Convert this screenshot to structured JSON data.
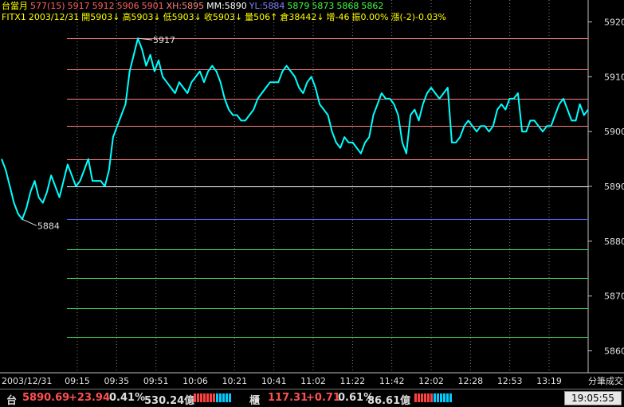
{
  "header": {
    "line1": [
      {
        "text": "台當月",
        "color": "#ffff00"
      },
      {
        "text": "577(15)",
        "color": "#ff6060"
      },
      {
        "text": "5917",
        "color": "#ff6060"
      },
      {
        "text": "5912",
        "color": "#ff6060"
      },
      {
        "text": "5906",
        "color": "#ff6060"
      },
      {
        "text": "5901",
        "color": "#ff6060"
      },
      {
        "text": "XH:5895",
        "color": "#ff8080"
      },
      {
        "text": "MM:5890",
        "color": "#ffffff"
      },
      {
        "text": "YL:5884",
        "color": "#8080ff"
      },
      {
        "text": "5879",
        "color": "#40ff40"
      },
      {
        "text": "5873",
        "color": "#40ff40"
      },
      {
        "text": "5868",
        "color": "#40ff40"
      },
      {
        "text": "5862",
        "color": "#40ff40"
      }
    ],
    "line2": [
      {
        "text": "FITX1",
        "color": "#ffff00"
      },
      {
        "text": "2003/12/31",
        "color": "#ffff00"
      },
      {
        "text": "開5903↓",
        "color": "#ffff00"
      },
      {
        "text": "高5903↓",
        "color": "#ffff00"
      },
      {
        "text": "低5903↓",
        "color": "#ffff00"
      },
      {
        "text": "收5903↓",
        "color": "#ffff00"
      },
      {
        "text": "量506↑",
        "color": "#ffff00"
      },
      {
        "text": "倉38442↓",
        "color": "#ffff00"
      },
      {
        "text": "增-46",
        "color": "#ffff00"
      },
      {
        "text": "振0.00%",
        "color": "#ffff00"
      },
      {
        "text": "漲(-2)-0.03%",
        "color": "#ffff00"
      }
    ]
  },
  "chart_data": {
    "type": "line",
    "date_label": "2003/12/31",
    "right_axis_label": "分筆成交",
    "ylim": [
      5856,
      5924
    ],
    "y_ticks": [
      5920,
      5910,
      5900,
      5890,
      5880,
      5870,
      5860
    ],
    "x_tick_labels": [
      "09:15",
      "09:35",
      "09:51",
      "10:06",
      "10:21",
      "10:41",
      "11:02",
      "11:22",
      "11:42",
      "12:02",
      "12:28",
      "12:53",
      "13:19"
    ],
    "reference_lines": [
      {
        "value": 5917,
        "color": "#ff8080"
      },
      {
        "value": 5911.3,
        "color": "#ff8080"
      },
      {
        "value": 5906,
        "color": "#ff8080"
      },
      {
        "value": 5901,
        "color": "#ff8080"
      },
      {
        "value": 5895,
        "color": "#ff8080"
      },
      {
        "value": 5890,
        "color": "#ffffff"
      },
      {
        "value": 5884,
        "color": "#6060ff"
      },
      {
        "value": 5878.5,
        "color": "#40e060"
      },
      {
        "value": 5873.3,
        "color": "#40e060"
      },
      {
        "value": 5867.8,
        "color": "#40e060"
      },
      {
        "value": 5862.5,
        "color": "#40e060"
      }
    ],
    "annotations": [
      {
        "label": "5917",
        "value": 5917,
        "kind": "max"
      },
      {
        "label": "5884",
        "value": 5884,
        "kind": "min"
      }
    ],
    "series": [
      {
        "color": "#00ffff",
        "values": [
          5895,
          5893,
          5890,
          5887,
          5885,
          5884,
          5886,
          5889,
          5891,
          5888,
          5887,
          5889,
          5892,
          5890,
          5888,
          5891,
          5894,
          5892,
          5890,
          5891,
          5893,
          5895,
          5891,
          5891,
          5891,
          5890,
          5893,
          5899,
          5901,
          5903,
          5905,
          5911,
          5914,
          5917,
          5915,
          5912,
          5914,
          5911,
          5913,
          5910,
          5909,
          5908,
          5907,
          5909,
          5908,
          5907,
          5909,
          5910,
          5911,
          5909,
          5911,
          5912,
          5911,
          5909,
          5906,
          5904,
          5903,
          5903,
          5902,
          5902,
          5903,
          5904,
          5906,
          5907,
          5908,
          5909,
          5909,
          5909,
          5911,
          5912,
          5911,
          5910,
          5908,
          5907,
          5909,
          5910,
          5908,
          5905,
          5904,
          5903,
          5900,
          5898,
          5897,
          5899,
          5898,
          5898,
          5897,
          5896,
          5898,
          5899,
          5903,
          5905,
          5907,
          5906,
          5906,
          5905,
          5903,
          5898,
          5896,
          5903,
          5904,
          5902,
          5905,
          5907,
          5908,
          5907,
          5906,
          5907,
          5908,
          5898,
          5898,
          5899,
          5901,
          5902,
          5901,
          5900,
          5901,
          5901,
          5900,
          5901,
          5904,
          5905,
          5904,
          5906,
          5906,
          5907,
          5900,
          5900,
          5902,
          5902,
          5901,
          5900,
          5901,
          5901,
          5903,
          5905,
          5906,
          5904,
          5902,
          5902,
          5905,
          5903,
          5904
        ]
      }
    ]
  },
  "statusbar": {
    "tai_label": "台",
    "tai_price": "5890.69",
    "tai_change": "+23.94",
    "tai_pct": "0.41%",
    "tai_amount": "530.24億",
    "otc_label": "櫃",
    "otc_price": "117.31",
    "otc_change": "+0.71",
    "otc_pct": "0.61%",
    "otc_amount": "86.61億",
    "clock": "19:05:55"
  }
}
